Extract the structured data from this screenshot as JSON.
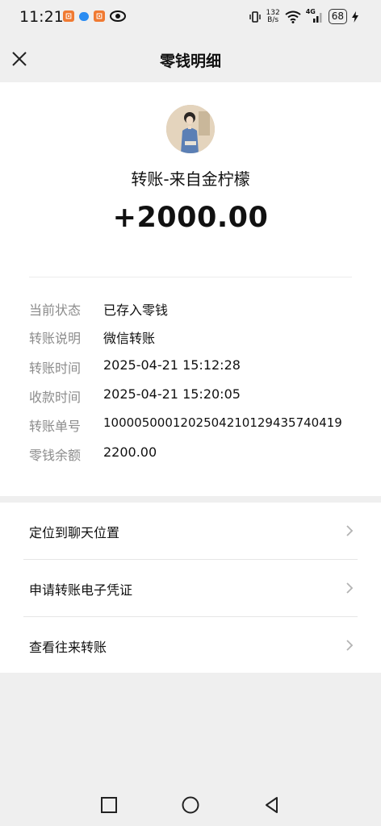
{
  "status_bar": {
    "time": "11:21",
    "net_speed_value": "132",
    "net_speed_unit": "B/s",
    "network_type": "4G",
    "battery": "68"
  },
  "header": {
    "title": "零钱明细",
    "close_icon": "close-icon"
  },
  "transfer": {
    "title": "转账-来自金柠檬",
    "amount": "+2000.00"
  },
  "details": [
    {
      "label": "当前状态",
      "value": "已存入零钱"
    },
    {
      "label": "转账说明",
      "value": "微信转账"
    },
    {
      "label": "转账时间",
      "value": "2025-04-21 15:12:28"
    },
    {
      "label": "收款时间",
      "value": "2025-04-21 15:20:05"
    },
    {
      "label": "转账单号",
      "value": "1000050001202504210129435740419"
    },
    {
      "label": "零钱余额",
      "value": "2200.00"
    }
  ],
  "actions": [
    {
      "label": "定位到聊天位置"
    },
    {
      "label": "申请转账电子凭证"
    },
    {
      "label": "查看往来转账"
    }
  ],
  "system_nav": {
    "icons": [
      "recent-apps-icon",
      "home-icon",
      "back-icon"
    ]
  },
  "colors": {
    "background": "#efefef",
    "card": "#ffffff",
    "label_gray": "#8c8c8c",
    "text": "#111111"
  }
}
